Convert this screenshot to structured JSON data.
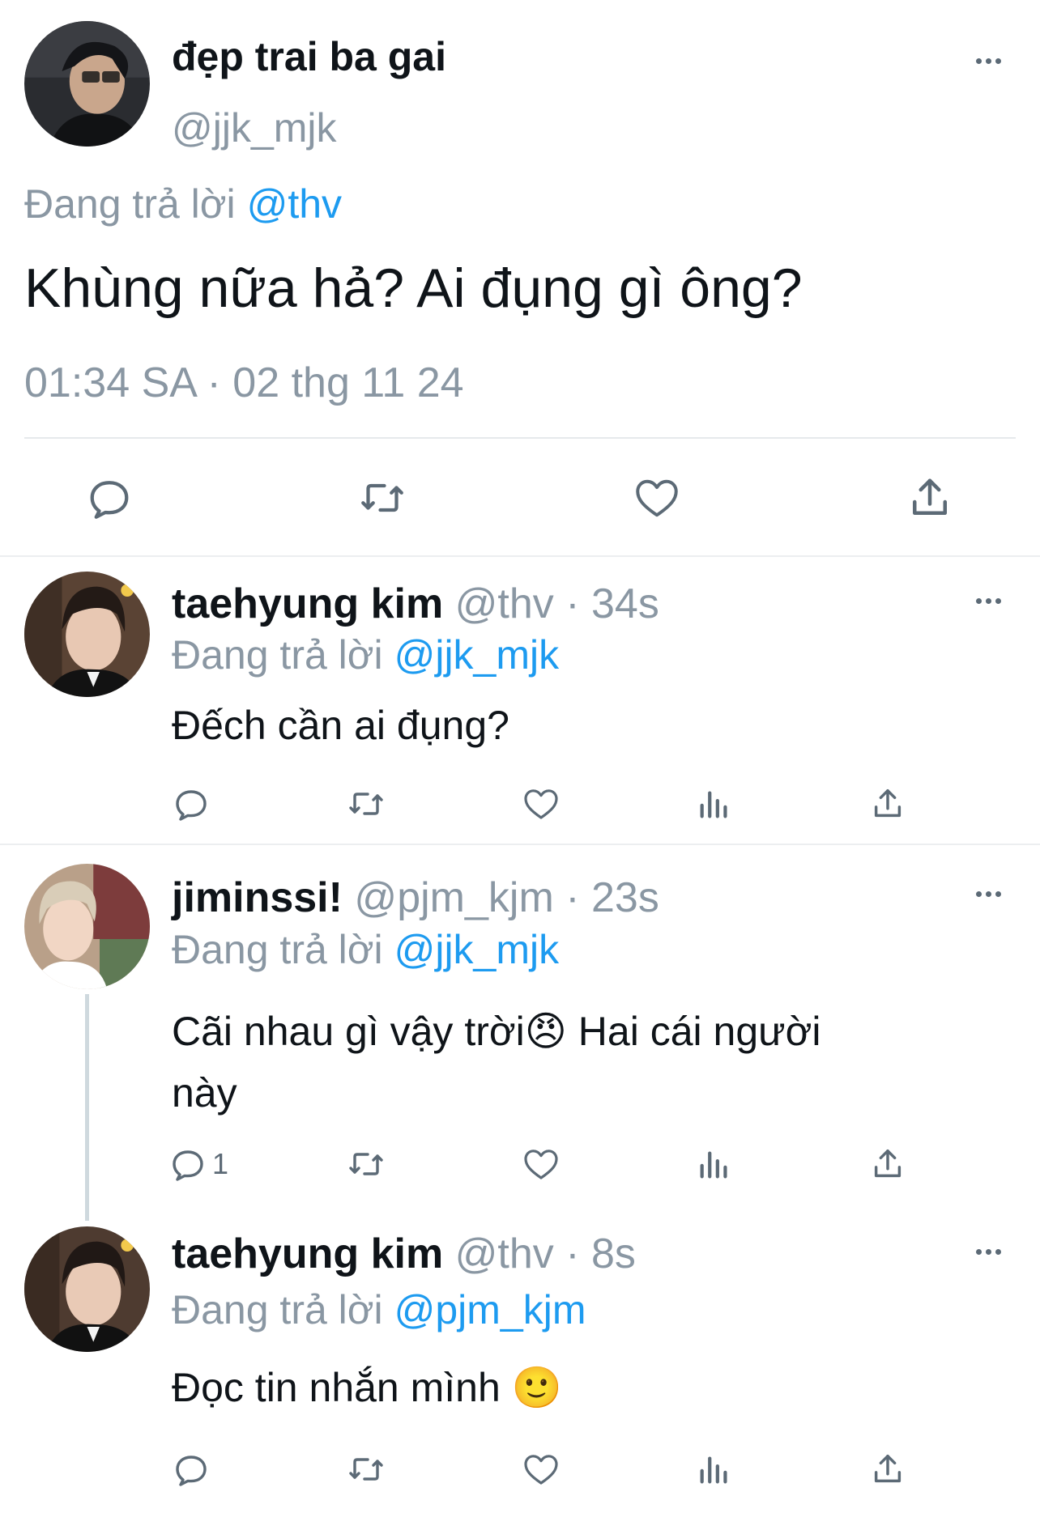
{
  "main_tweet": {
    "display_name": "đẹp trai ba gai",
    "handle": "@jjk_mjk",
    "replying_prefix": "Đang trả lời",
    "replying_to": "@thv",
    "text": "Khùng nữa hả? Ai đụng gì ông?",
    "timestamp": "01:34 SA · 02 thg 11 24",
    "actions": [
      "reply-icon",
      "retweet-icon",
      "like-icon",
      "share-icon"
    ]
  },
  "replies": [
    {
      "display_name": "taehyung kim",
      "handle": "@thv",
      "time": "· 34s",
      "replying_prefix": "Đang trả lời",
      "replying_to": "@jjk_mjk",
      "text": "Đếch cần ai đụng?",
      "reply_count": ""
    },
    {
      "display_name": "jiminssi!",
      "handle": "@pjm_kjm",
      "time": "· 23s",
      "replying_prefix": "Đang trả lời",
      "replying_to": "@jjk_mjk",
      "text_line1": "Cãi nhau gì vậy trời😠 Hai cái người",
      "text_line2": "này",
      "reply_count": "1"
    },
    {
      "display_name": "taehyung kim",
      "handle": "@thv",
      "time": "· 8s",
      "replying_prefix": "Đang trả lời",
      "replying_to": "@pjm_kjm",
      "text": "Đọc tin nhắn mình 🙂",
      "reply_count": ""
    }
  ],
  "colors": {
    "accent_blue": "#1d9bf0",
    "secondary_text": "#8a97a3",
    "icon_gray": "#5c6a76",
    "divider": "#eceef0"
  }
}
